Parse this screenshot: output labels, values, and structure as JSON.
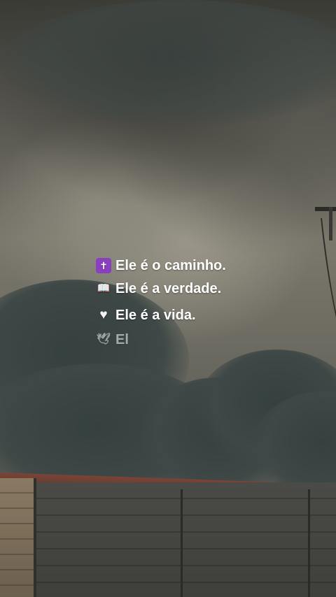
{
  "colors": {
    "text": "#ffffff",
    "cross_badge": "#8a3fbf"
  },
  "lines": [
    {
      "icon": "latin-cross-emoji",
      "glyph": "✝",
      "text": "Ele é o caminho."
    },
    {
      "icon": "open-book-emoji",
      "glyph": "📖",
      "text": "Ele é a verdade."
    },
    {
      "icon": "white-heart-emoji",
      "glyph": "♥",
      "text": "Ele é a vida."
    },
    {
      "icon": "dove-emoji",
      "glyph": "🕊",
      "text": "El"
    }
  ]
}
